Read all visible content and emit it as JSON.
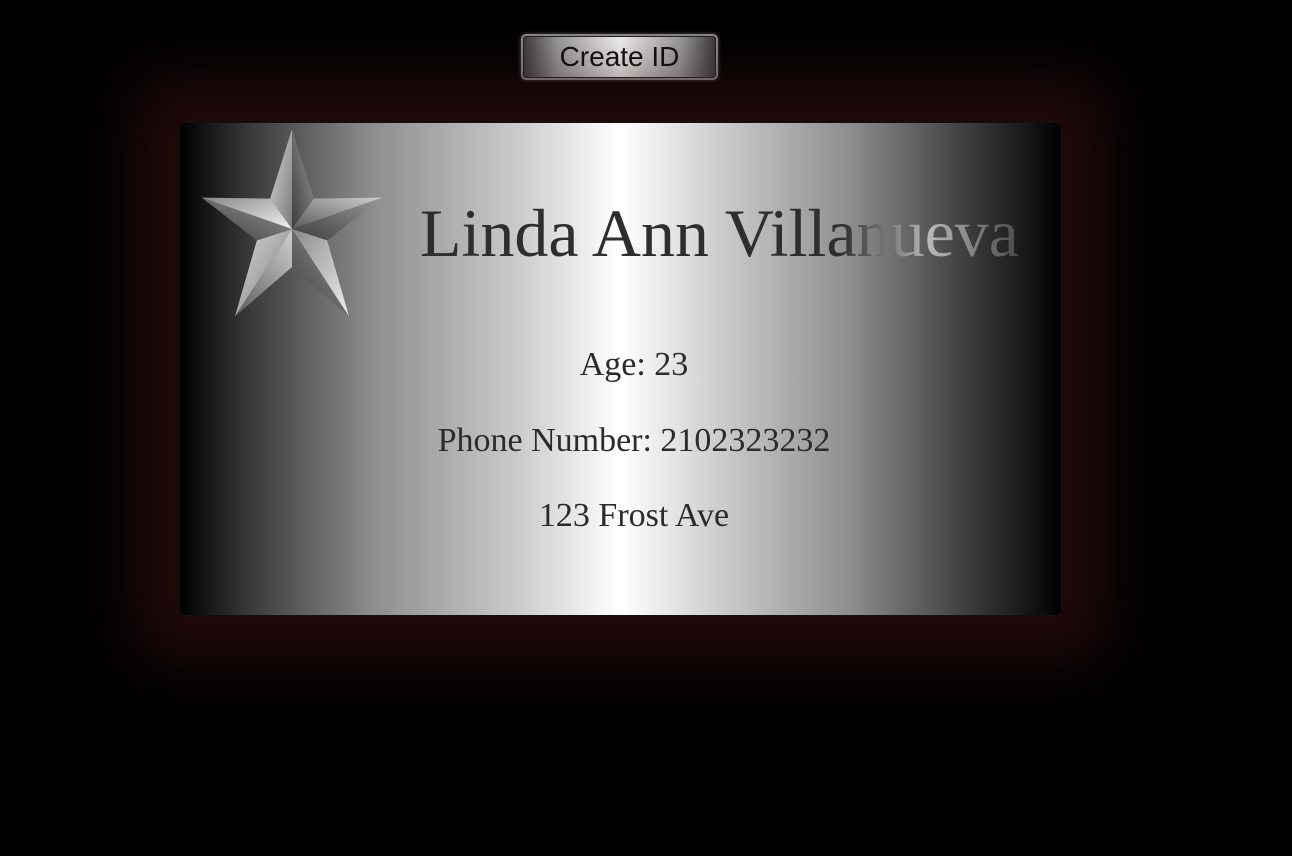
{
  "button": {
    "label": "Create ID"
  },
  "card": {
    "name": "Linda Ann Villanueva",
    "age_line": "Age: 23",
    "phone_line": "Phone Number: 2102323232",
    "address_line": "123 Frost Ave",
    "emblem_icon": "star-icon"
  },
  "colors": {
    "background": "#000000",
    "glow": "#3c1212",
    "card_highlight": "#ffffff",
    "text": "#2b2b2b"
  }
}
